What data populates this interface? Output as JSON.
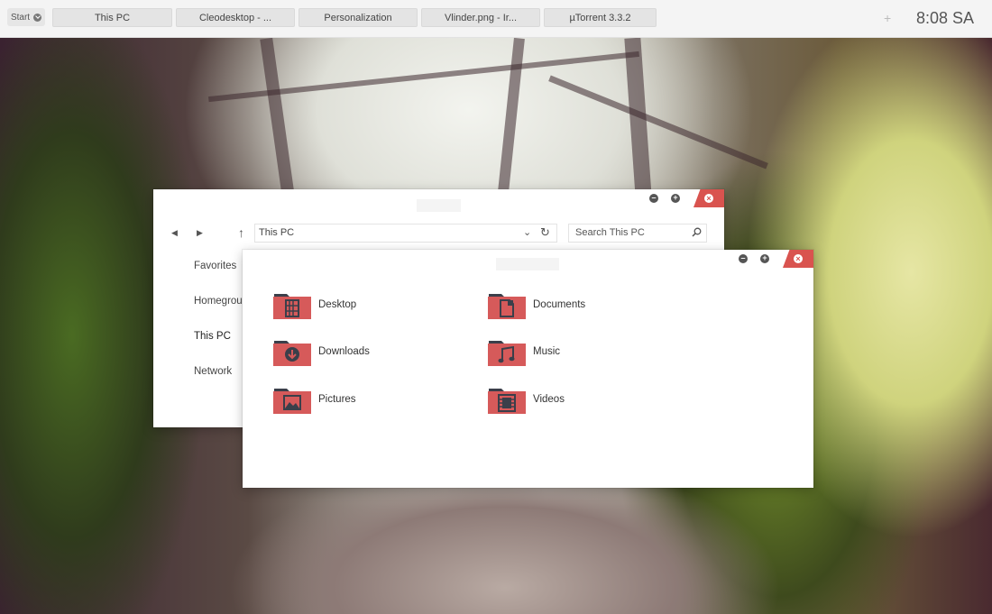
{
  "taskbar": {
    "start_label": "Start",
    "tasks": [
      "This PC",
      "Cleodesktop - ...",
      "Personalization",
      "Vlinder.png - Ir...",
      "µTorrent 3.3.2"
    ],
    "tray_plus": "+",
    "clock": "8:08 SA"
  },
  "explorer": {
    "address": "This PC",
    "search_placeholder": "Search This PC",
    "sidebar": [
      "Favorites",
      "Homegroup",
      "This PC",
      "Network"
    ],
    "active_sidebar": "This PC"
  },
  "library_window": {
    "folders": [
      {
        "label": "Desktop",
        "icon": "desktop-folder-icon"
      },
      {
        "label": "Documents",
        "icon": "documents-folder-icon"
      },
      {
        "label": "Downloads",
        "icon": "downloads-folder-icon"
      },
      {
        "label": "Music",
        "icon": "music-folder-icon"
      },
      {
        "label": "Pictures",
        "icon": "pictures-folder-icon"
      },
      {
        "label": "Videos",
        "icon": "videos-folder-icon"
      }
    ]
  },
  "colors": {
    "accent_red": "#d9534f",
    "folder_body": "#d65a5a",
    "folder_tab": "#3b3f4a",
    "taskbar_bg": "#f4f4f4"
  }
}
